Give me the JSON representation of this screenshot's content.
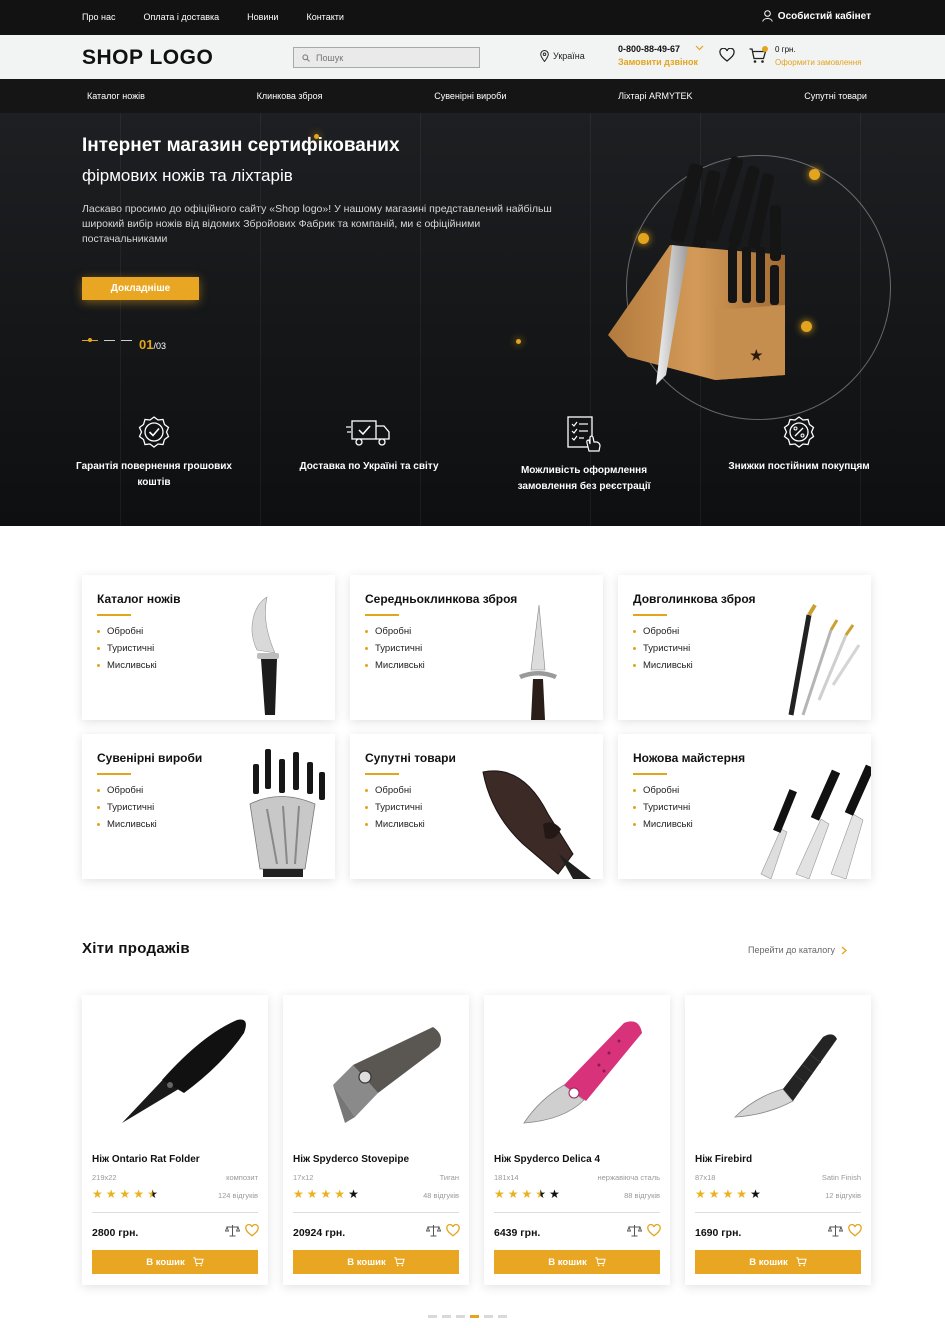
{
  "topbar": {
    "links": [
      "Про нас",
      "Оплата і доставка",
      "Новини",
      "Контакти"
    ],
    "cabinet": "Особистий кабінет"
  },
  "header": {
    "logo": "SHOP LOGO",
    "search_placeholder": "Пошук",
    "region": "Україна",
    "phone": "0-800-88-49-67",
    "callback": "Замовити дзвінок",
    "cart_total": "0 грн.",
    "cart_order": "Оформити замовлення"
  },
  "nav": [
    "Каталог ножів",
    "Клинкова зброя",
    "Сувенірні вироби",
    "Ліхтарі ARMYTEK",
    "Супутні товари"
  ],
  "hero": {
    "title1": "Інтернет магазин сертифікованих",
    "title2": "фірмових ножів та ліхтарів",
    "text": "Ласкаво просимо до офіційного сайту «Shop logo»! У нашому магазині представлений найбільш широкий вибір ножів від відомих Збройових Фабрик та компаній, ми є офіційними постачальниками",
    "button": "Докладніше",
    "slide_current": "01",
    "slide_total": "/03"
  },
  "features": [
    {
      "icon": "guarantee-badge-icon",
      "label": "Гарантія повернення грошових коштів"
    },
    {
      "icon": "delivery-truck-icon",
      "label": "Доставка по Україні та світу"
    },
    {
      "icon": "checklist-icon",
      "label": "Можливість оформлення замовлення без реєстрації"
    },
    {
      "icon": "discount-badge-icon",
      "label": "Знижки постійним покупцям"
    }
  ],
  "categories": [
    {
      "title": "Каталог ножів",
      "items": [
        "Обробні",
        "Туристичні",
        "Мисливські"
      ]
    },
    {
      "title": "Середньоклинкова зброя",
      "items": [
        "Обробні",
        "Туристичні",
        "Мисливські"
      ]
    },
    {
      "title": "Довголинкова зброя",
      "items": [
        "Обробні",
        "Туристичні",
        "Мисливські"
      ]
    },
    {
      "title": "Сувенірні вироби",
      "items": [
        "Обробні",
        "Туристичні",
        "Мисливські"
      ]
    },
    {
      "title": "Супутні товари",
      "items": [
        "Обробні",
        "Туристичні",
        "Мисливські"
      ]
    },
    {
      "title": "Ножова майстерня",
      "items": [
        "Обробні",
        "Туристичні",
        "Мисливські"
      ]
    }
  ],
  "hits": {
    "title": "Хіти продажів",
    "link": "Перейти до каталогу"
  },
  "products": [
    {
      "name": "Ніж Ontario Rat Folder",
      "size": "219x22",
      "material": "композит",
      "rating": 4.5,
      "reviews": "124 відгуків",
      "price": "2800 грн.",
      "buy": "В кошик"
    },
    {
      "name": "Ніж Spyderco Stovepipe",
      "size": "17x12",
      "material": "Тиган",
      "rating": 4,
      "reviews": "48 відгуків",
      "price": "20924 грн.",
      "buy": "В кошик"
    },
    {
      "name": "Ніж Spyderco Delica 4",
      "size": "181x14",
      "material": "нержавіюча сталь",
      "rating": 3.5,
      "reviews": "88 відгуків",
      "price": "6439 грн.",
      "buy": "В кошик"
    },
    {
      "name": "Ніж Firebird",
      "size": "87x18",
      "material": "Satin Finish",
      "rating": 4,
      "reviews": "12 відгуків",
      "price": "1690 грн.",
      "buy": "В кошик"
    }
  ],
  "pager": {
    "count": 6,
    "active": 3
  },
  "colors": {
    "accent": "#e9a622",
    "dark": "#121212",
    "header_bg": "#f2f3f3"
  }
}
